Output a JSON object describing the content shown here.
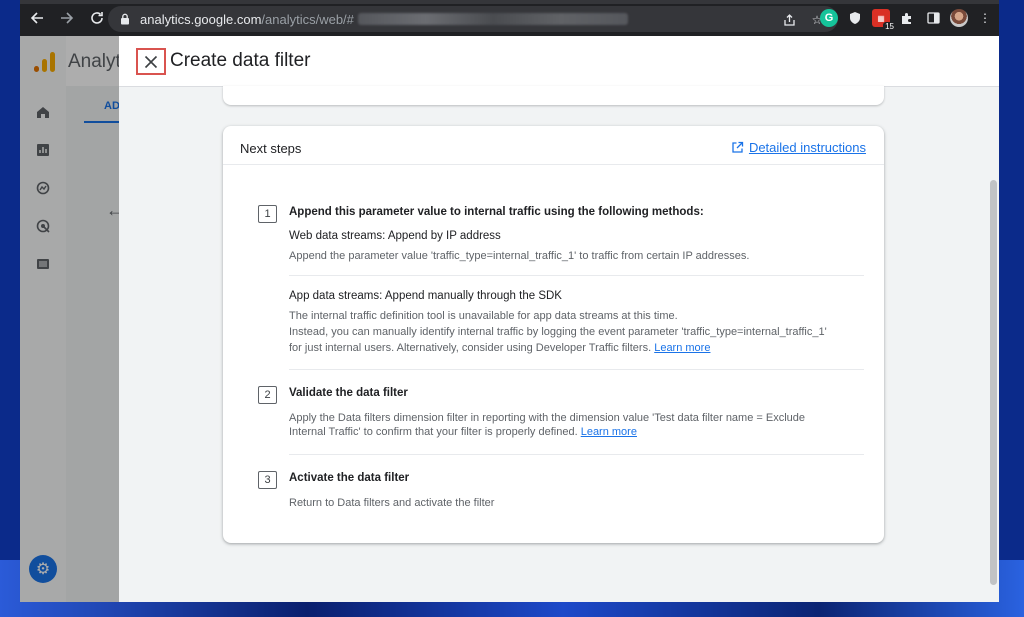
{
  "browser": {
    "url_host": "analytics.google.com",
    "url_path": "/analytics/web/#",
    "extension_badge": "15"
  },
  "background_app": {
    "title": "Analyt",
    "tab_label": "AD"
  },
  "drawer": {
    "title": "Create data filter",
    "close_label": "✕"
  },
  "card": {
    "title": "Next steps",
    "instructions_link": "Detailed instructions"
  },
  "steps": [
    {
      "number": "1",
      "title": "Append this parameter value to internal traffic using the following methods:",
      "web_title": "Web data streams: Append by IP address",
      "web_desc": "Append the parameter value 'traffic_type=internal_traffic_1' to traffic from certain IP addresses.",
      "app_title": "App data streams: Append manually through the SDK",
      "app_desc_1": "The internal traffic definition tool is unavailable for app data streams at this time.",
      "app_desc_2": "Instead, you can manually identify internal traffic by logging the event parameter 'traffic_type=internal_traffic_1'",
      "app_desc_3": "for just internal users. Alternatively, consider using Developer Traffic filters.",
      "learn_more": "Learn more"
    },
    {
      "number": "2",
      "title": "Validate the data filter",
      "desc_1": "Apply the Data filters dimension filter in reporting with the dimension value 'Test data filter name = Exclude",
      "desc_2": "Internal Traffic' to confirm that your filter is properly defined.",
      "learn_more": "Learn more"
    },
    {
      "number": "3",
      "title": "Activate the data filter",
      "desc": "Return to Data filters and activate the filter"
    }
  ],
  "icons": {
    "back": "back-arrow-icon",
    "forward": "forward-arrow-icon",
    "reload": "reload-icon",
    "lock": "lock-icon",
    "share": "share-icon",
    "star": "star-icon",
    "extensions": "puzzle-icon",
    "close": "close-icon",
    "external": "open-in-new-icon",
    "settings": "gear-icon"
  },
  "colors": {
    "accent": "#1a73e8",
    "close_highlight": "#d9534f"
  }
}
